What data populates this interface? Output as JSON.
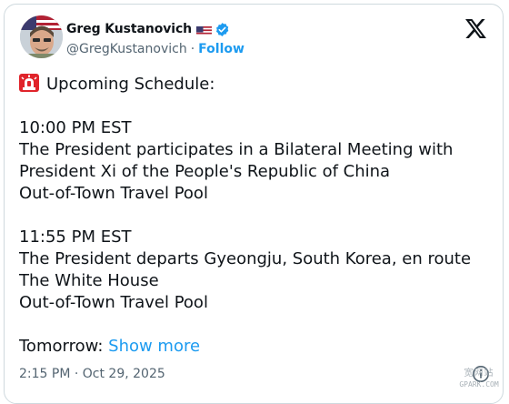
{
  "author": {
    "name": "Greg Kustanovich",
    "handle": "@GregKustanovich",
    "separator": "·",
    "follow_label": "Follow"
  },
  "tweet": {
    "header": "Upcoming Schedule:",
    "event1_time": "10:00 PM EST",
    "event1_line1": "The President participates in a Bilateral Meeting with",
    "event1_line2": "President Xi of the People's Republic of China",
    "event1_pool": "Out-of-Town Travel Pool",
    "event2_time": "11:55 PM EST",
    "event2_line1": "The President departs Gyeongju, South Korea, en route",
    "event2_line2": "The White House",
    "event2_pool": "Out-of-Town Travel Pool",
    "tomorrow_label": "Tomorrow:",
    "show_more_label": "Show more",
    "timestamp": "2:15 PM · Oct 29, 2025"
  },
  "watermark": {
    "top": "宽网站",
    "bottom": "GPARK.COM"
  },
  "icons": {
    "flag": "us-flag-icon",
    "verified": "verified-badge-icon",
    "brand": "x-logo-icon",
    "siren": "siren-emoji-icon",
    "info": "info-icon"
  },
  "colors": {
    "text": "#0f1419",
    "secondary": "#536471",
    "accent": "#1d9bf0",
    "border": "#cfd9de",
    "siren_red": "#e0242b"
  }
}
